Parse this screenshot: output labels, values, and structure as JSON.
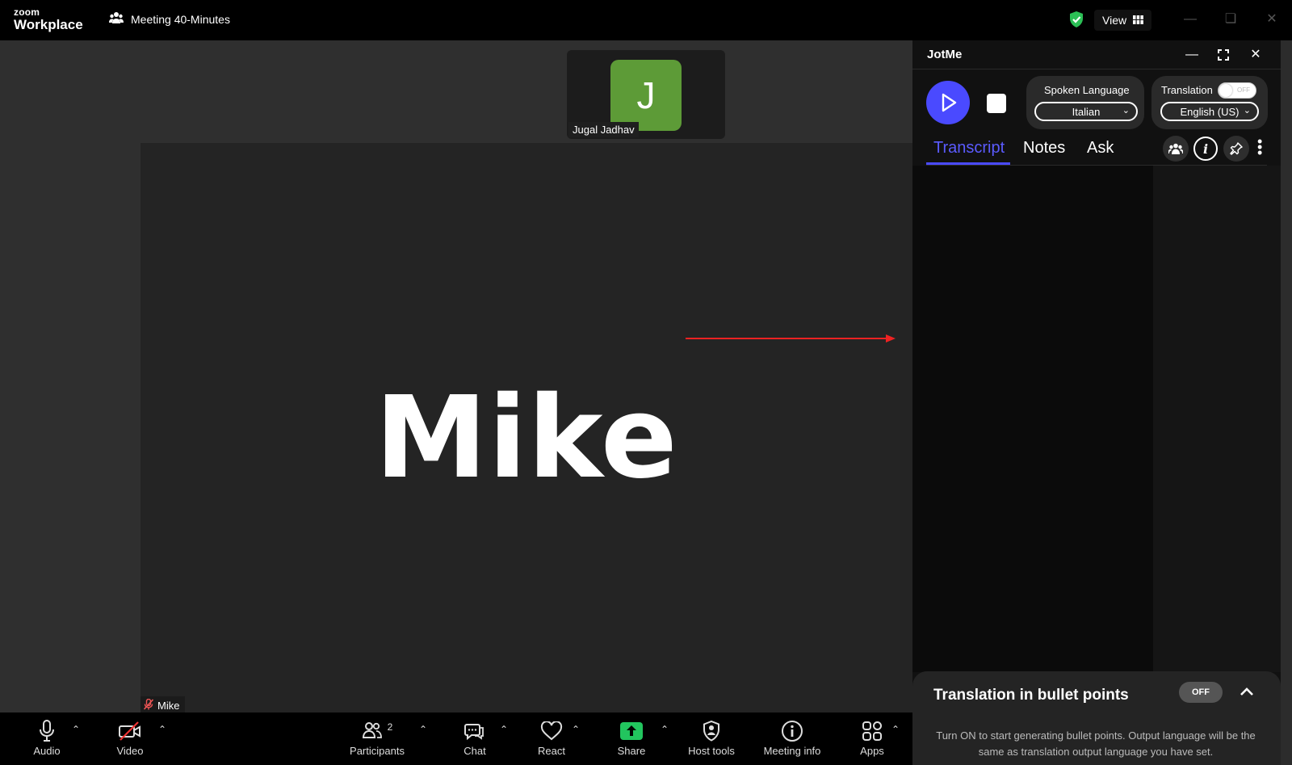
{
  "app": {
    "logo_line1": "zoom",
    "logo_line2": "Workplace"
  },
  "meeting": {
    "title": "Meeting 40-Minutes",
    "view_label": "View"
  },
  "stage": {
    "active_speaker": "Mike",
    "active_label": "Mike",
    "thumbnail": {
      "initial": "J",
      "name": "Jugal Jadhav",
      "avatar_color": "#5d9b37"
    }
  },
  "toolbar": {
    "audio": "Audio",
    "video": "Video",
    "participants": "Participants",
    "participants_count": "2",
    "chat": "Chat",
    "react": "React",
    "share": "Share",
    "host_tools": "Host tools",
    "meeting_info": "Meeting info",
    "apps": "Apps"
  },
  "jotme": {
    "title": "JotMe",
    "spoken_language_label": "Spoken Language",
    "spoken_language_value": "Italian",
    "translation_label": "Translation",
    "translation_toggle": "OFF",
    "translation_value": "English (US)",
    "tabs": [
      "Transcript",
      "Notes",
      "Ask"
    ],
    "active_tab": "Transcript",
    "bullets_title": "Translation in bullet points",
    "bullets_toggle": "OFF",
    "bullets_desc": "Turn ON to start generating bullet points. Output language will be the same as translation output language you have set.",
    "accent_color": "#4a4aff"
  }
}
